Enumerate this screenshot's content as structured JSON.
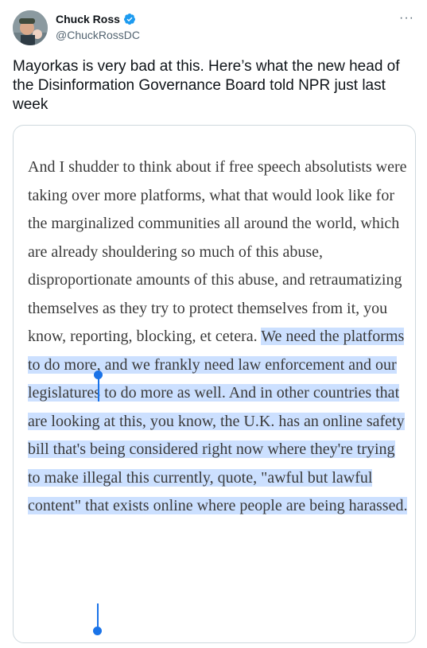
{
  "author": {
    "name": "Chuck Ross",
    "handle": "@ChuckRossDC",
    "verified": true,
    "verified_icon": "verified-badge-icon",
    "verified_color": "#1d9bf0"
  },
  "more_menu": {
    "label": "···",
    "icon": "more-options-icon"
  },
  "tweet": {
    "text": "Mayorkas is very bad at this. Here’s what the new head of the Disinformation Governance Board told NPR just last week"
  },
  "media": {
    "quote_plain": "And I shudder to think about if free speech absolutists were taking over more platforms, what that would look like for the marginalized communities all around the world, which are already shouldering so much of this abuse, disproportionate amounts of this abuse, and retraumatizing themselves as they try to protect themselves from it, you know, reporting, blocking, et cetera. ",
    "quote_highlighted": "We need the platforms to do more, and we frankly need law enforcement and our legislatures to do more as well. And in other countries that are looking at this, you know, the U.K. has an online safety bill that's being considered right now where they're trying to make illegal this currently, quote, \"awful but lawful content\" that exists online where people are being harassed.",
    "highlight_color": "#cce0ff",
    "selection_handle_color": "#1a73e8"
  }
}
